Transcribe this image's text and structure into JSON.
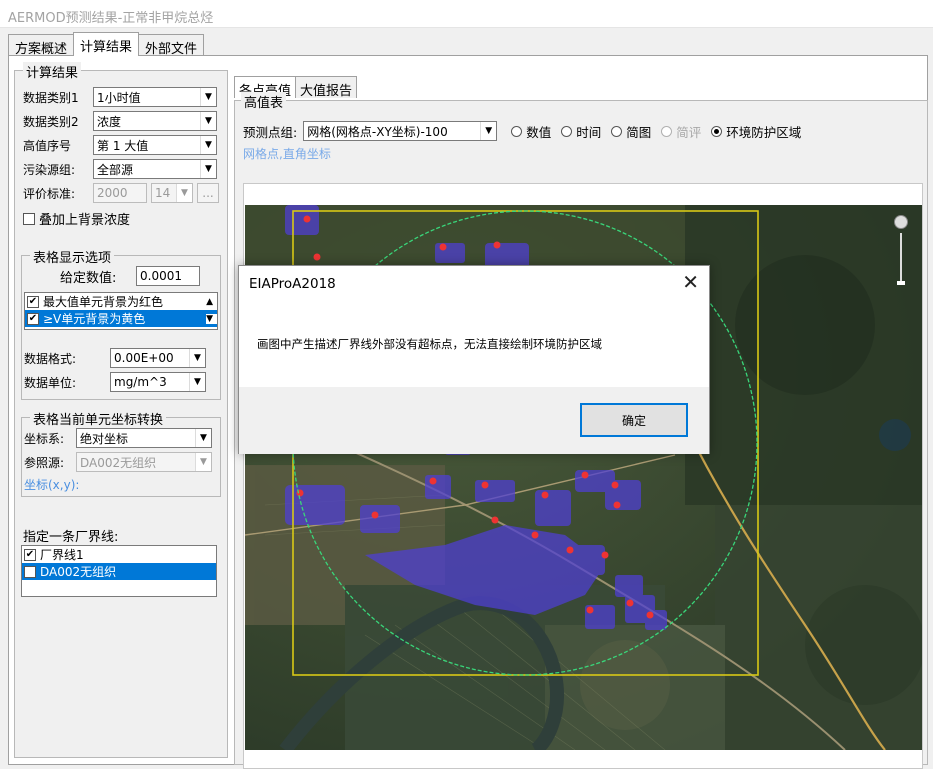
{
  "window": {
    "title": "AERMOD预测结果-正常非甲烷总烃"
  },
  "main_tabs": [
    "方案概述",
    "计算结果",
    "外部文件"
  ],
  "result_group": {
    "legend": "计算结果",
    "data_class1": {
      "label": "数据类别1",
      "value": "1小时值"
    },
    "data_class2": {
      "label": "数据类别2",
      "value": "浓度"
    },
    "rank": {
      "label": "高值序号",
      "value": "第 1 大值"
    },
    "source_group": {
      "label": "污染源组:",
      "value": "全部源"
    },
    "standard": {
      "label": "评价标准:",
      "value": "2000",
      "value2": "14",
      "btn": "..."
    },
    "overlay_bg": {
      "label": "叠加上背景浓度",
      "checked": false
    }
  },
  "table_options": {
    "legend": "表格显示选项",
    "given_value": {
      "label": "给定数值:",
      "value": "0.0001"
    },
    "list": [
      {
        "label": "最大值单元背景为红色",
        "checked": true,
        "selected": false
      },
      {
        "label": "≥V单元背景为黄色",
        "checked": true,
        "selected": true
      }
    ],
    "format": {
      "label": "数据格式:",
      "value": "0.00E+00"
    },
    "unit": {
      "label": "数据单位:",
      "value": "mg/m^3"
    }
  },
  "coord_group": {
    "legend": "表格当前单元坐标转换",
    "system": {
      "label": "坐标系:",
      "value": "绝对坐标"
    },
    "reference": {
      "label": "参照源:",
      "value": "DA002无组织"
    },
    "coord_label": "坐标(x,y):"
  },
  "boundary": {
    "label": "指定一条厂界线:",
    "items": [
      {
        "label": "厂界线1",
        "checked": true,
        "selected": false
      },
      {
        "label": "DA002无组织",
        "checked": false,
        "selected": true
      }
    ]
  },
  "right_tabs": [
    "各点高值",
    "大值报告"
  ],
  "high_table": {
    "legend": "高值表",
    "predict_label": "预测点组:",
    "predict_value": "网格(网格点-XY坐标)-100",
    "radio_options": [
      {
        "label": "数值",
        "checked": false,
        "disabled": false
      },
      {
        "label": "时间",
        "checked": false,
        "disabled": false
      },
      {
        "label": "简图",
        "checked": false,
        "disabled": false
      },
      {
        "label": "简评",
        "checked": false,
        "disabled": true
      },
      {
        "label": "环境防护区域",
        "checked": true,
        "disabled": false
      }
    ],
    "subtitle": "网格点,直角坐标"
  },
  "dialog": {
    "title": "EIAProA2018",
    "message": "画图中产生描述厂界线外部没有超标点，无法直接绘制环境防护区域",
    "ok_label": "确定"
  },
  "colors": {
    "accent": "#0078d7",
    "link_blue": "#4a8fe0",
    "circle_green": "#39d67a",
    "square_yellow": "#d8c816",
    "overlay_purple": "#4f3fd6"
  }
}
